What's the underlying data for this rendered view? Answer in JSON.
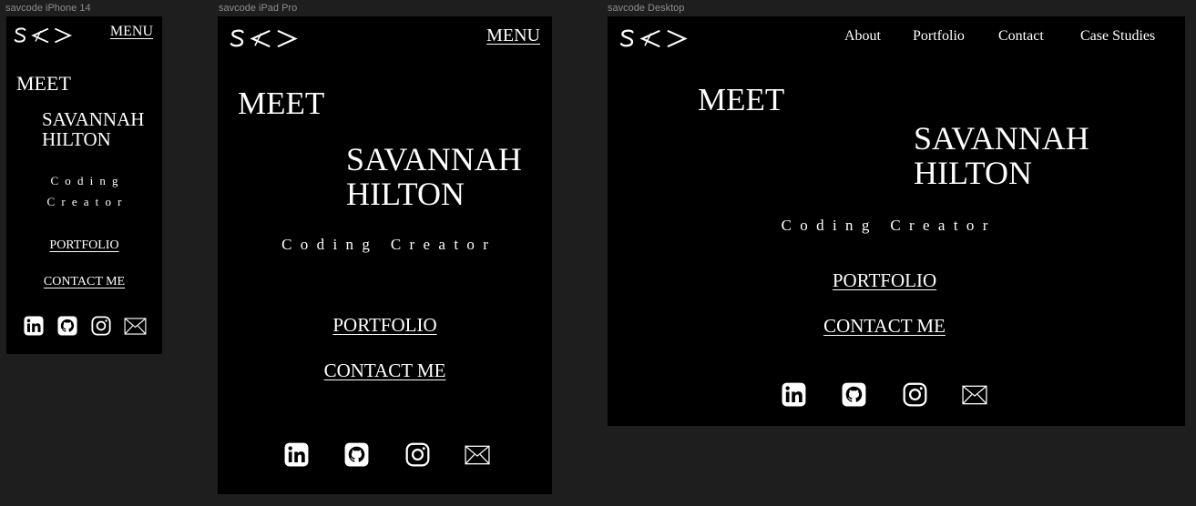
{
  "frames": {
    "phone": {
      "label": "savcode iPhone 14",
      "menu": "MENU",
      "meet": "MEET",
      "name_line1": "SAVANNAH",
      "name_line2": "HILTON",
      "tagline_line1": "Coding",
      "tagline_line2": "Creator",
      "portfolio": "PORTFOLIO",
      "contact": "CONTACT ME"
    },
    "tablet": {
      "label": "savcode iPad Pro",
      "menu": "MENU",
      "meet": "MEET",
      "name_line1": "SAVANNAH",
      "name_line2": "HILTON",
      "tagline": "Coding Creator",
      "portfolio": "PORTFOLIO",
      "contact": "CONTACT ME"
    },
    "desktop": {
      "label": "savcode Desktop",
      "nav": [
        "About",
        "Portfolio",
        "Contact",
        "Case Studies"
      ],
      "meet": "MEET",
      "name_line1": "SAVANNAH",
      "name_line2": "HILTON",
      "tagline": "Coding Creator",
      "portfolio": "PORTFOLIO",
      "contact": "CONTACT ME"
    }
  },
  "logo_text": "S<>",
  "social_icons": [
    "linkedin-icon",
    "github-icon",
    "instagram-icon",
    "mail-icon"
  ],
  "colors": {
    "canvas": "#1e1e1e",
    "frame": "#000000",
    "text": "#ffffff",
    "label": "#8c8c8c"
  }
}
